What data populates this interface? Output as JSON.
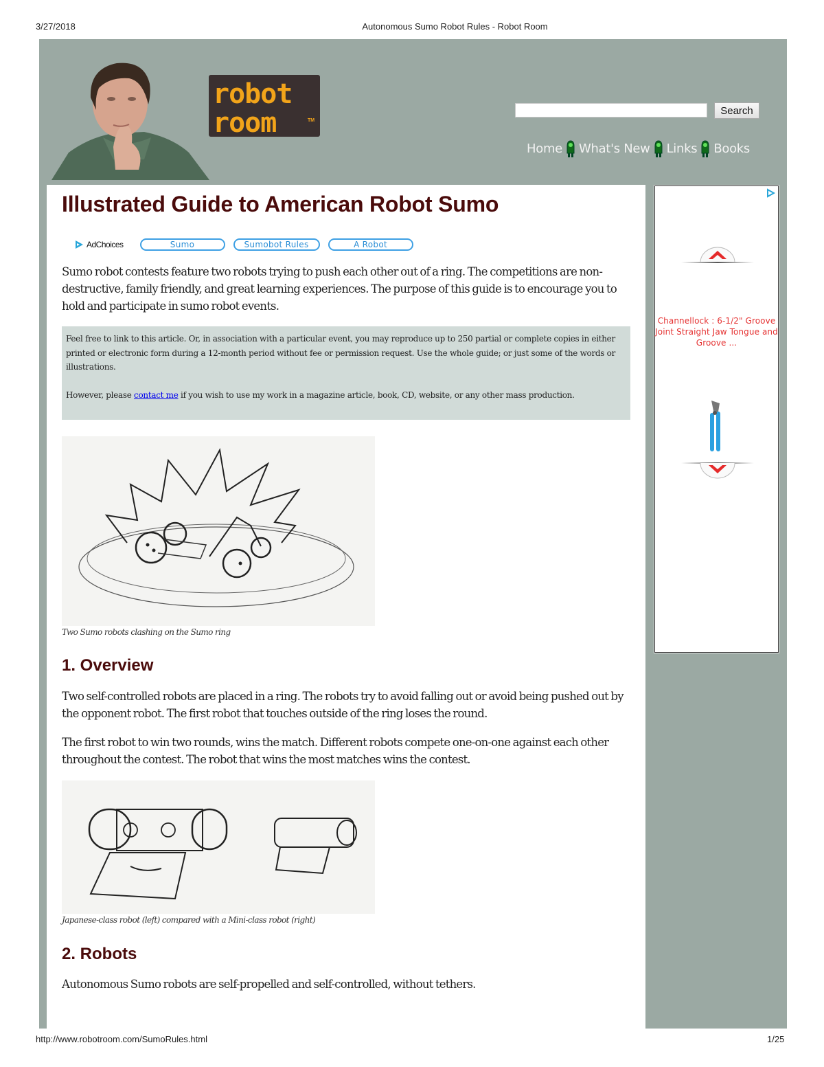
{
  "print_header": {
    "date": "3/27/2018",
    "title": "Autonomous Sumo Robot Rules - Robot Room"
  },
  "print_footer": {
    "url": "http://www.robotroom.com/SumoRules.html",
    "page": "1/25"
  },
  "masthead": {
    "portrait_alt": "Site author portrait",
    "logo_text": [
      "robot",
      "room"
    ],
    "logo_tm": "TM"
  },
  "search": {
    "value": "",
    "placeholder": "",
    "button_label": "Search"
  },
  "nav": {
    "items": [
      {
        "label": "Home",
        "icon": "green-led-icon"
      },
      {
        "label": "What's New",
        "icon": "green-led-icon"
      },
      {
        "label": "Links",
        "icon": "green-led-icon"
      },
      {
        "label": "Books",
        "icon": null
      }
    ]
  },
  "colors": {
    "frame": "#9ba9a3",
    "heading": "#4a0b0b",
    "notice_bg": "#d1dbd8",
    "pill": "#3ea0e4",
    "ad_text": "#e53232",
    "link": "#0000ee"
  },
  "article": {
    "title": "Illustrated Guide to American Robot Sumo",
    "ad_links": {
      "adchoices_label": "AdChoices",
      "pills": [
        "Sumo",
        "Sumobot Rules",
        "A Robot"
      ]
    },
    "intro": "Sumo robot contests feature two robots trying to push each other out of a ring. The competitions are non-destructive, family friendly, and great learning experiences. The purpose of this guide is to encourage you to hold and participate in sumo robot events.",
    "notice": {
      "p1": "Feel free to link to this article. Or, in association with a particular event, you may reproduce up to 250 partial or complete copies in either printed or electronic form during a 12-month period without fee or permission request. Use the whole guide; or just some of the words or illustrations.",
      "p2_before": "However, please ",
      "p2_link": "contact me",
      "p2_after": " if you wish to use my work in a magazine article, book, CD, website, or any other mass production."
    },
    "figure1_caption": "Two Sumo robots clashing on the Sumo ring",
    "section1_title": "1. Overview",
    "section1_p1": "Two self-controlled robots are placed in a ring. The robots try to avoid falling out or avoid being pushed out by the opponent robot. The first robot that touches outside of the ring loses the round.",
    "section1_p2": "The first robot to win two rounds, wins the match. Different robots compete one-on-one against each other throughout the contest. The robot that wins the most matches wins the contest.",
    "figure2_caption": "Japanese-class robot (left) compared with a Mini-class robot (right)",
    "section2_title": "2. Robots",
    "section2_p1": "Autonomous Sumo robots are self-propelled and self-controlled, without tethers."
  },
  "sidebar_ad": {
    "product_text": "Channellock : 6-1/2\" Groove Joint Straight Jaw Tongue and Groove ...",
    "up_arrow_icon": "chevron-up-icon",
    "down_arrow_icon": "chevron-down-icon",
    "product_image": "pliers-icon"
  }
}
